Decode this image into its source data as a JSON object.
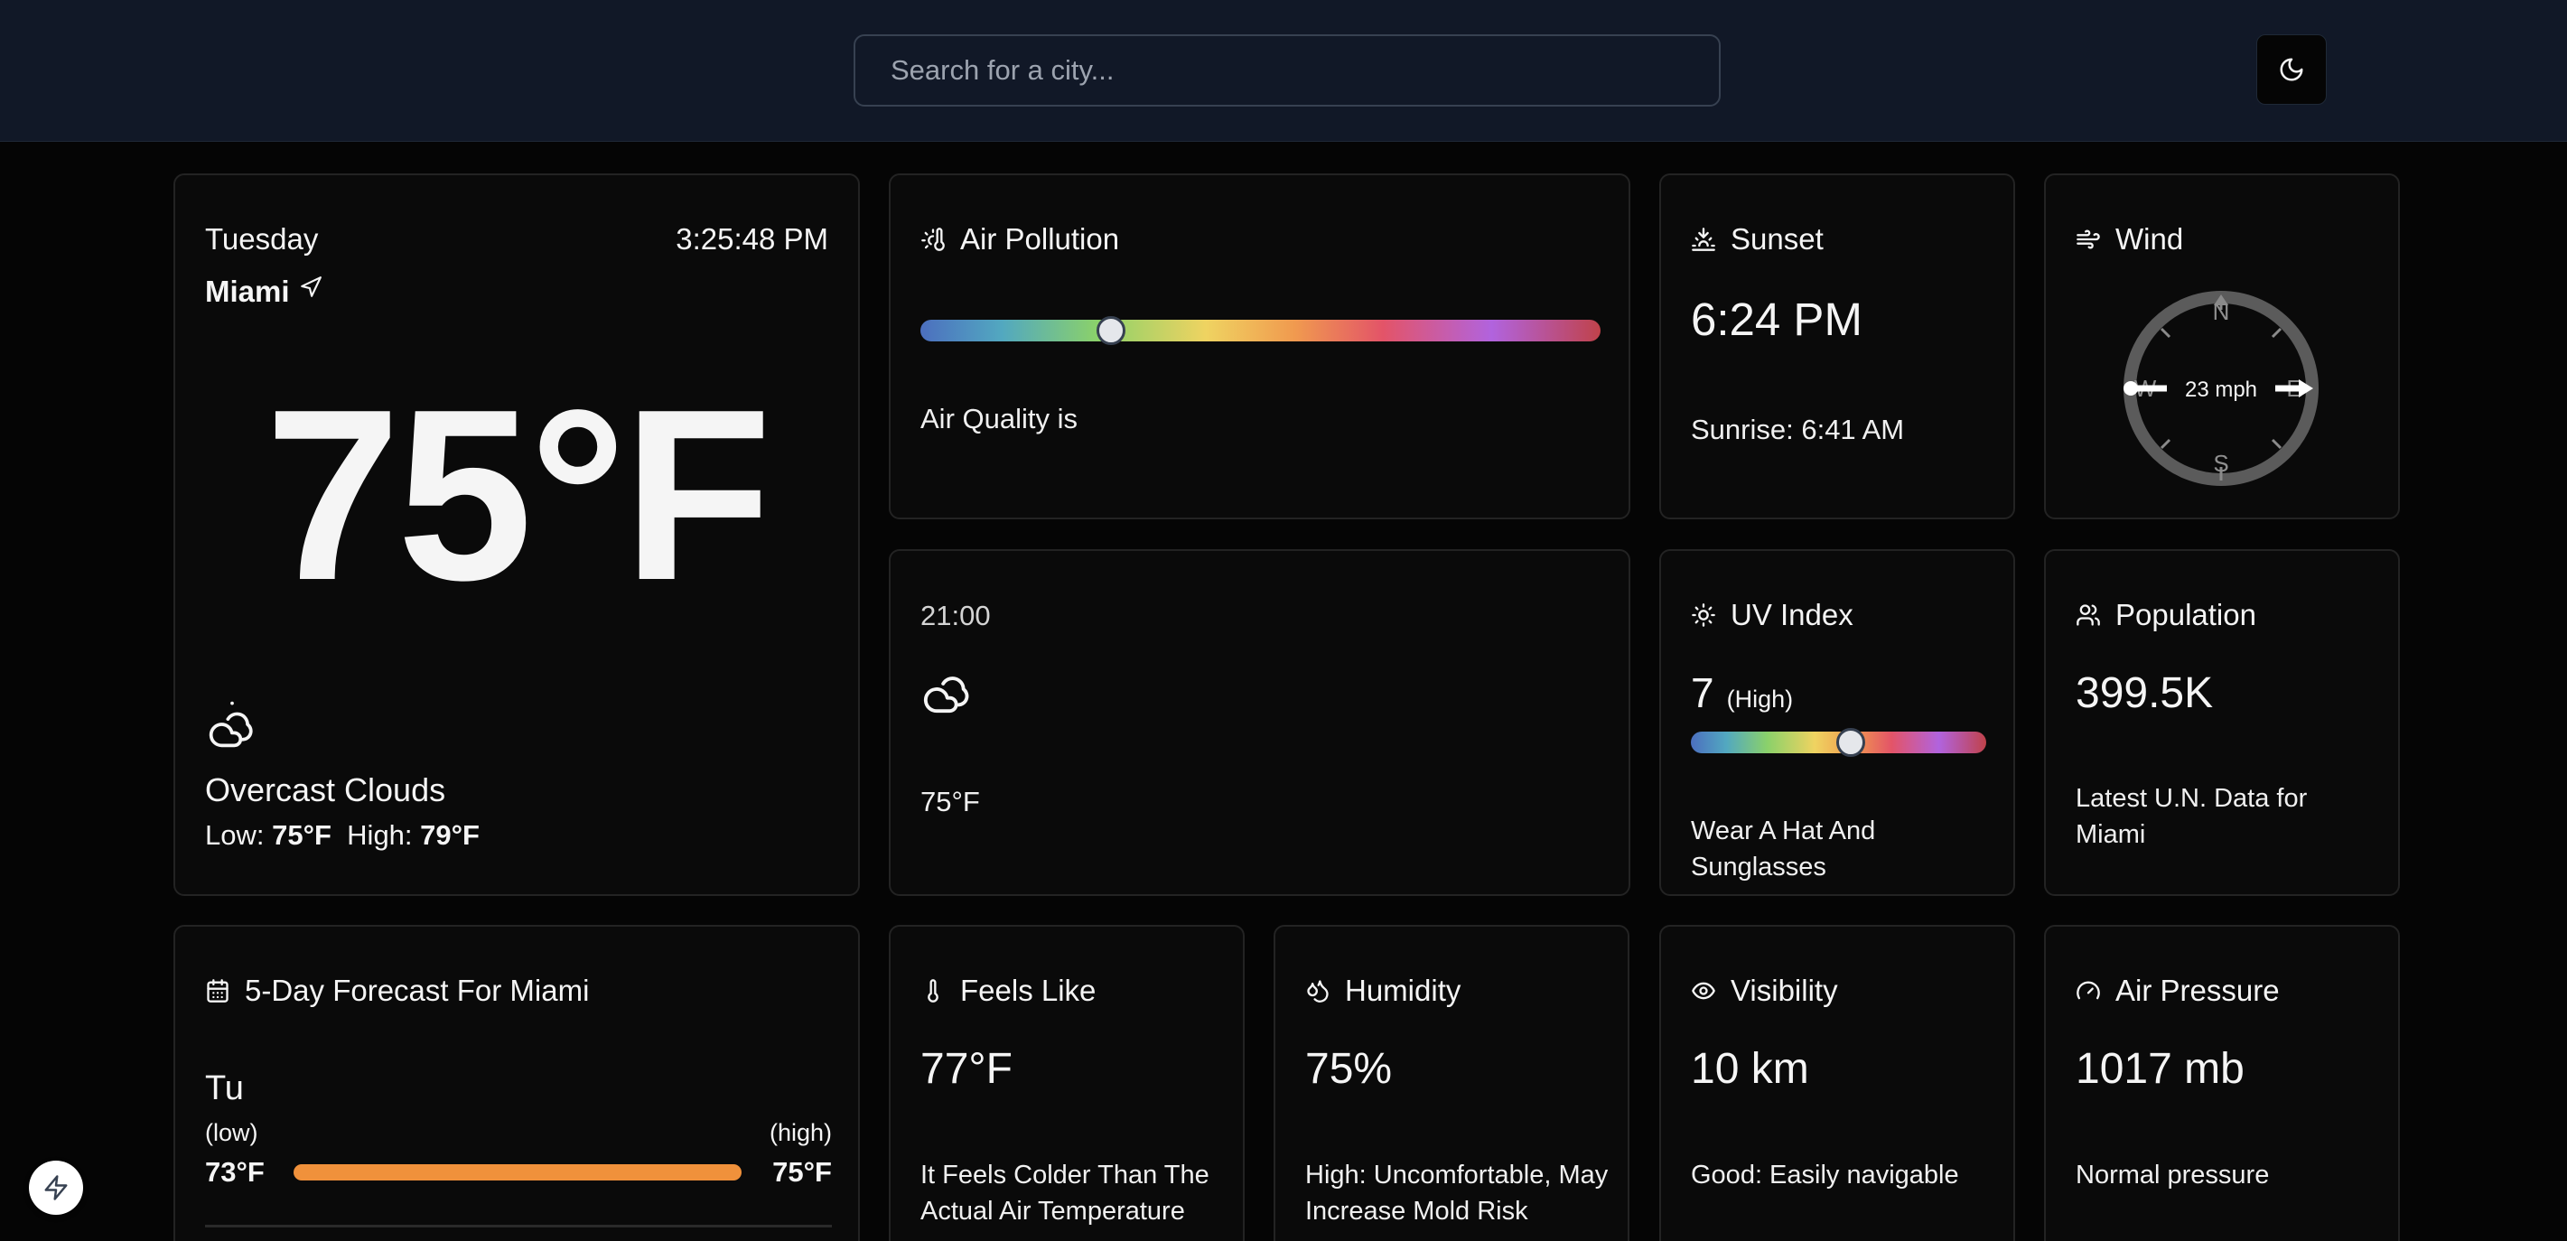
{
  "search": {
    "placeholder": "Search for a city..."
  },
  "current": {
    "day": "Tuesday",
    "time": "3:25:48 PM",
    "city": "Miami",
    "temperature": "75°F",
    "condition": "Overcast Clouds",
    "low_label": "Low:",
    "low": "75°F",
    "high_label": "High:",
    "high": "79°F"
  },
  "air_pollution": {
    "title": "Air Pollution",
    "level_fraction": 0.28,
    "text": "Air Quality is"
  },
  "sunset": {
    "title": "Sunset",
    "time": "6:24 PM",
    "sunrise": "Sunrise: 6:41 AM"
  },
  "wind": {
    "title": "Wind",
    "speed": "23 mph",
    "directions": {
      "n": "N",
      "e": "E",
      "s": "S",
      "w": "W"
    },
    "direction_degrees": 90
  },
  "hourly": {
    "time": "21:00",
    "temp": "75°F"
  },
  "uv": {
    "title": "UV Index",
    "value": "7",
    "label": "(High)",
    "level_fraction": 0.54,
    "advice": "Wear A Hat And Sunglasses"
  },
  "population": {
    "title": "Population",
    "value": "399.5K",
    "text": "Latest U.N. Data for Miami"
  },
  "forecast": {
    "title": "5-Day Forecast For Miami",
    "days": [
      {
        "day": "Tu",
        "low_label": "(low)",
        "high_label": "(high)",
        "low": "73°F",
        "high": "75°F"
      }
    ],
    "bar_color": "#f0913b"
  },
  "feels_like": {
    "title": "Feels Like",
    "value": "77°F",
    "text": "It Feels Colder Than The Actual Air Temperature"
  },
  "humidity": {
    "title": "Humidity",
    "value": "75%",
    "text": "High: Uncomfortable, May Increase Mold Risk"
  },
  "visibility": {
    "title": "Visibility",
    "value": "10 km",
    "text": "Good: Easily navigable"
  },
  "pressure": {
    "title": "Air Pressure",
    "value": "1017 mb",
    "text": "Normal pressure"
  }
}
